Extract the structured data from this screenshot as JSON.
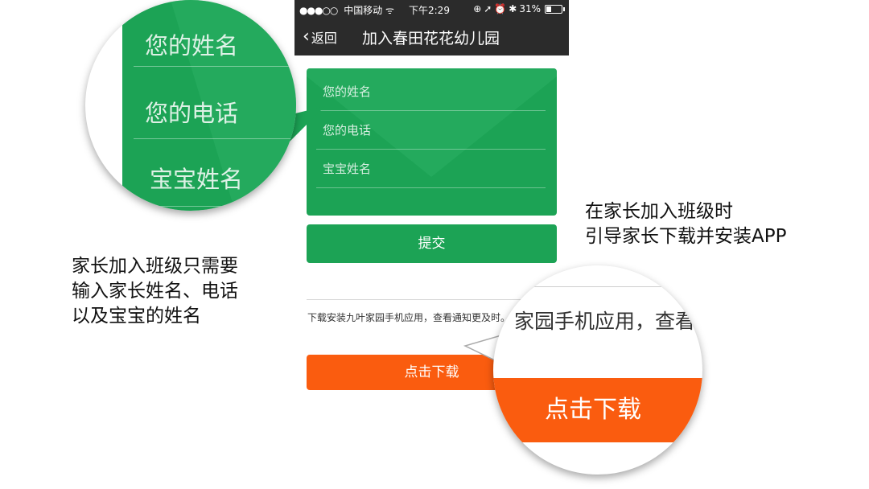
{
  "status_bar": {
    "signal_dots": "●●●○○",
    "carrier": "中国移动",
    "time": "下午2:29",
    "battery": "31%"
  },
  "nav": {
    "back_label": "返回",
    "title": "加入春田花花幼儿园"
  },
  "form": {
    "fields": [
      {
        "placeholder": "您的姓名"
      },
      {
        "placeholder": "您的电话"
      },
      {
        "placeholder": "宝宝姓名"
      }
    ],
    "submit_label": "提交"
  },
  "promo": {
    "text": "下载安装九叶家园手机应用，查看通知更及时。",
    "download_label": "点击下载"
  },
  "zoom_form": {
    "field_1": "您的姓名",
    "field_2": "您的电话",
    "field_3": "宝宝姓名"
  },
  "zoom_download": {
    "text": "家园手机应用，查看",
    "button": "点击下载"
  },
  "annotations": {
    "left": [
      "家长加入班级只需要",
      "输入家长姓名、电话",
      "以及宝宝的姓名"
    ],
    "right": [
      "在家长加入班级时",
      "引导家长下载并安装APP"
    ]
  },
  "colors": {
    "accent_green": "#1ca355",
    "accent_orange": "#fa5c0f",
    "navbar_bg": "#2b2b2b"
  }
}
